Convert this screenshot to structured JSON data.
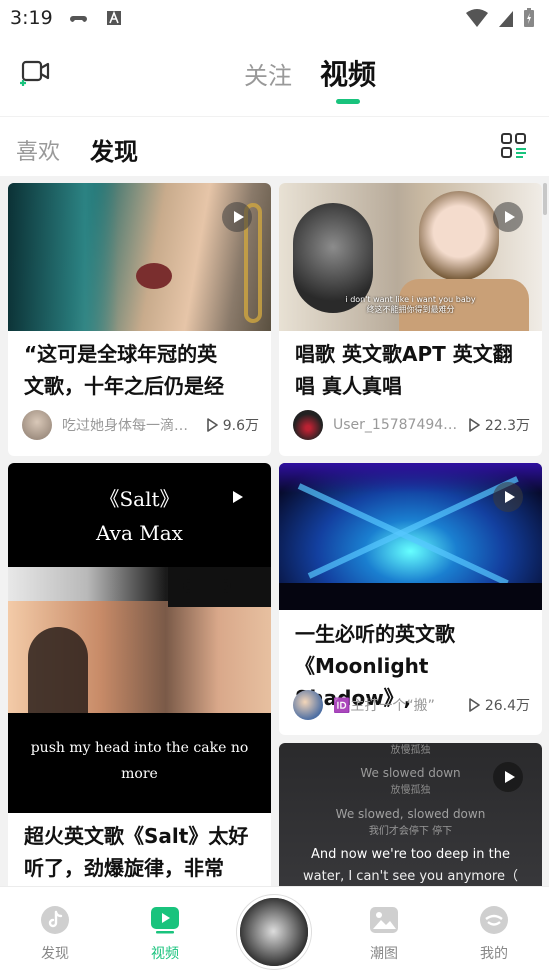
{
  "status": {
    "time": "3:19"
  },
  "header": {
    "tabs": [
      "关注",
      "视频"
    ],
    "active_tab": "视频"
  },
  "subtabs": [
    "喜欢",
    "发现"
  ],
  "cards": [
    {
      "title": "“这可是全球年冠的英文歌，十年之后仍是经",
      "title_lines": [
        "“这可是全球年冠的英",
        "文歌，十年之后仍是经"
      ],
      "author": "吃过她身体每一滴…",
      "views": "9.6万"
    },
    {
      "title": "唱歌 英文歌APT 英文翻唱 真人真唱",
      "title_lines": [
        "唱歌 英文歌APT 英文翻",
        "唱 真人真唱"
      ],
      "author": "User_157874948…",
      "views": "22.3万",
      "caption_en": "i don't want  like i want you baby",
      "caption_cn": "终这不能拥你得到最难分"
    },
    {
      "title": "超火英文歌《Salt》太好听了，劲爆旋律，非常",
      "title_lines": [
        "超火英文歌《Salt》太好",
        "听了，劲爆旋律，非常"
      ],
      "thumb_title": "《Salt》",
      "thumb_artist": "Ava  Max",
      "thumb_lyric": "push  my  head  into  the  cake  no  more"
    },
    {
      "title": "一生必听的英文歌《Moonlight Shadow》,",
      "title_lines": [
        "一生必听的英文歌",
        "《Moonlight Shadow》,"
      ],
      "author": "🆔主打一个“搬”",
      "views": "26.4万"
    },
    {
      "lyrics": [
        "放慢孤独",
        "We slowed down",
        "放慢孤独",
        "We slowed, slowed down",
        "我们才会停下 停下",
        "And now we're too deep in the",
        "water, I can't see you anymore（"
      ]
    }
  ],
  "bottom_nav": {
    "items": [
      "发现",
      "视频",
      "潮图",
      "我的"
    ],
    "active": "视频"
  },
  "colors": {
    "accent": "#19c37d",
    "inactive_text": "#999999"
  },
  "icons": [
    "camera-add-icon",
    "grid-menu-icon",
    "play-icon",
    "tiktok-note-icon",
    "video-play-icon",
    "image-icon",
    "profile-face-icon"
  ]
}
